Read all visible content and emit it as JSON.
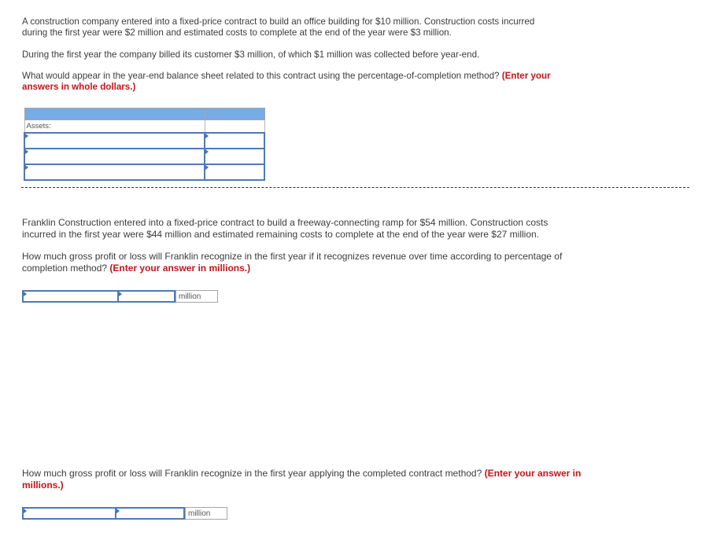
{
  "question1": {
    "paragraph1": "A construction company entered into a fixed-price contract to build an office building for $10 million. Construction costs incurred during the first year were $2 million and estimated costs to complete at the end of the year were $3 million.",
    "paragraph1_line1": "A construction company entered into a fixed-price contract to build an office building for $10 million. Construction costs incurred",
    "paragraph1_line2": "during the first year were $2 million and estimated costs to complete at the end of the year were $3 million.",
    "paragraph2": "During the first year the company billed its customer $3 million, of which $1 million was collected before year-end.",
    "question_line1": "What would appear in the year-end balance sheet related to this contract using the percentage-of-completion method?",
    "instruction_part1": "(Enter your",
    "instruction_part2": "answers in whole dollars.)",
    "table": {
      "header": [
        "",
        ""
      ],
      "section_label": "Assets:",
      "rows": [
        {
          "label_value": "",
          "amount_value": ""
        },
        {
          "label_value": "",
          "amount_value": ""
        },
        {
          "label_value": "",
          "amount_value": ""
        }
      ]
    }
  },
  "question2": {
    "paragraph_line1": "Franklin Construction entered into a fixed-price contract to build a freeway-connecting ramp for $54 million. Construction costs",
    "paragraph_line2": "incurred in the first year were $44 million and estimated remaining costs to complete at the end of the year were $27 million.",
    "question_line1": "How much gross profit or loss will Franklin recognize in the first year if it recognizes revenue over time according to percentage of",
    "question_line2": "completion method?",
    "instruction": "(Enter your answer in millions.)",
    "answer": {
      "type_value": "",
      "amount_value": "",
      "unit": "million"
    }
  },
  "question3": {
    "question_line1": "How much gross profit or loss will Franklin recognize in the first year applying the completed contract method?",
    "instruction_part1": "(Enter your answer in",
    "instruction_part2": "millions.)",
    "answer": {
      "type_value": "",
      "amount_value": "",
      "unit": "million"
    }
  }
}
